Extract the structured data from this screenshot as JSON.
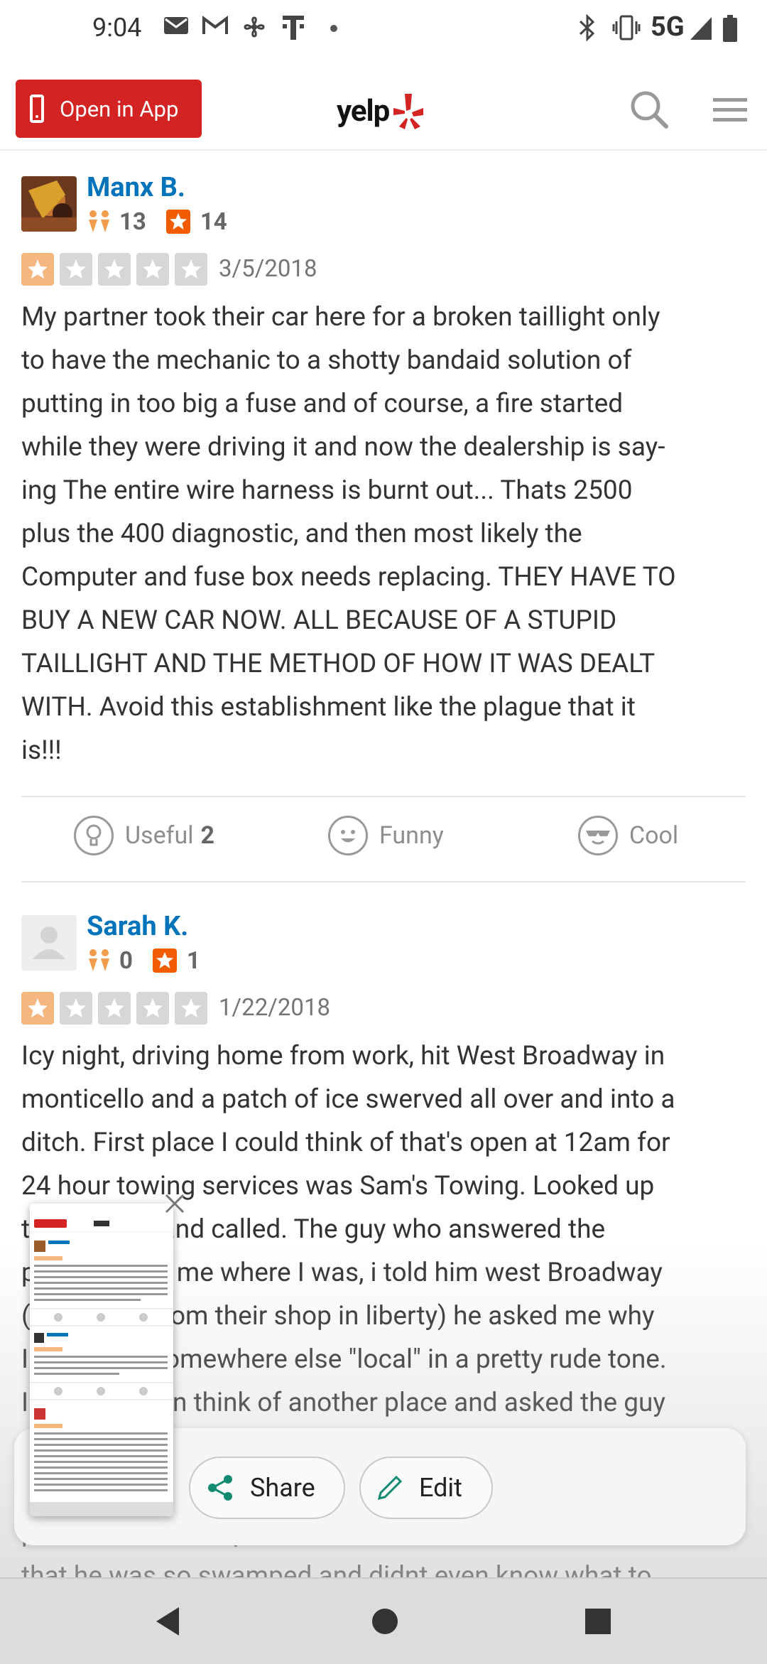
{
  "status_bar": {
    "time": "9:04",
    "network": "5G",
    "left_icons": [
      "mail-icon",
      "gmail-icon",
      "fan-icon",
      "tmobile-icon",
      "dot-icon"
    ],
    "right_icons": [
      "bluetooth-icon",
      "vibrate-icon",
      "signal-icon",
      "battery-icon"
    ]
  },
  "header": {
    "open_app_label": "Open in App",
    "logo_text": "yelp",
    "brand_color": "#d32323"
  },
  "reviews": [
    {
      "user_name": "Manx B.",
      "friends": "13",
      "review_count": "14",
      "rating": 1,
      "date": "3/5/2018",
      "text": "My partner took their car here for a broken taillight only\nto have the mechanic to a shotty bandaid solution of\nputting in too big a fuse and of course, a fire started\nwhile they were driving it and now the dealership is say-\ning The entire wire harness is burnt out... Thats 2500\nplus the 400 diagnostic, and then most likely the\nComputer and fuse box needs replacing. THEY HAVE TO\nBUY A NEW CAR NOW. ALL BECAUSE OF A STUPID\nTAILLIGHT AND THE METHOD OF HOW IT WAS DEALT\nWITH. Avoid this establishment like the plague that it\nis!!!",
      "votes": {
        "useful_label": "Useful",
        "useful_count": "2",
        "funny_label": "Funny",
        "cool_label": "Cool"
      }
    },
    {
      "user_name": "Sarah K.",
      "friends": "0",
      "review_count": "1",
      "rating": 1,
      "date": "1/22/2018",
      "text": "Icy night, driving home from work, hit West Broadway in\nmonticello and a patch of ice swerved all over and into a\nditch. First place I could think of that's open at 12am for\n24 hour towing services was Sam's Towing. Looked up\nthe number and called. The guy who answered the\nphone asked me where I was, i told him west Broadway\n(5 minutes from their shop in liberty) he asked me why\nI didn't call somewhere else \"local\" in a pretty rude tone.\nI couldn't even think of another place and asked the guy\nto please come. He said my car pulled out of\nthe ditch, and I had to call 2 other\nplaces before. He proceeded to tell me\nthat he was so swamped and didnt even know what to"
    }
  ],
  "share_panel": {
    "share_label": "Share",
    "edit_label": "Edit"
  },
  "nav_bar": {
    "buttons": [
      "back",
      "home",
      "recents"
    ]
  }
}
